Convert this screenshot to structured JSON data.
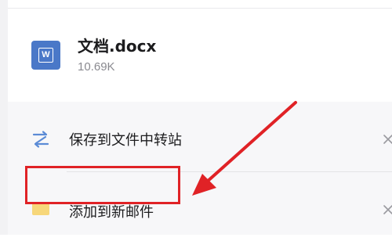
{
  "file": {
    "icon_letter": "W",
    "name": "文档.docx",
    "size": "10.69K"
  },
  "actions": [
    {
      "label": "保存到文件中转站",
      "icon": "transfer-icon",
      "close": "×"
    },
    {
      "label": "添加到新邮件",
      "icon": "folder-icon",
      "close": "×"
    }
  ],
  "colors": {
    "word_blue": "#4a78c8",
    "folder_yellow": "#f7d77a",
    "transfer_blue": "#5b8bd6",
    "annotation_red": "#e02226"
  }
}
